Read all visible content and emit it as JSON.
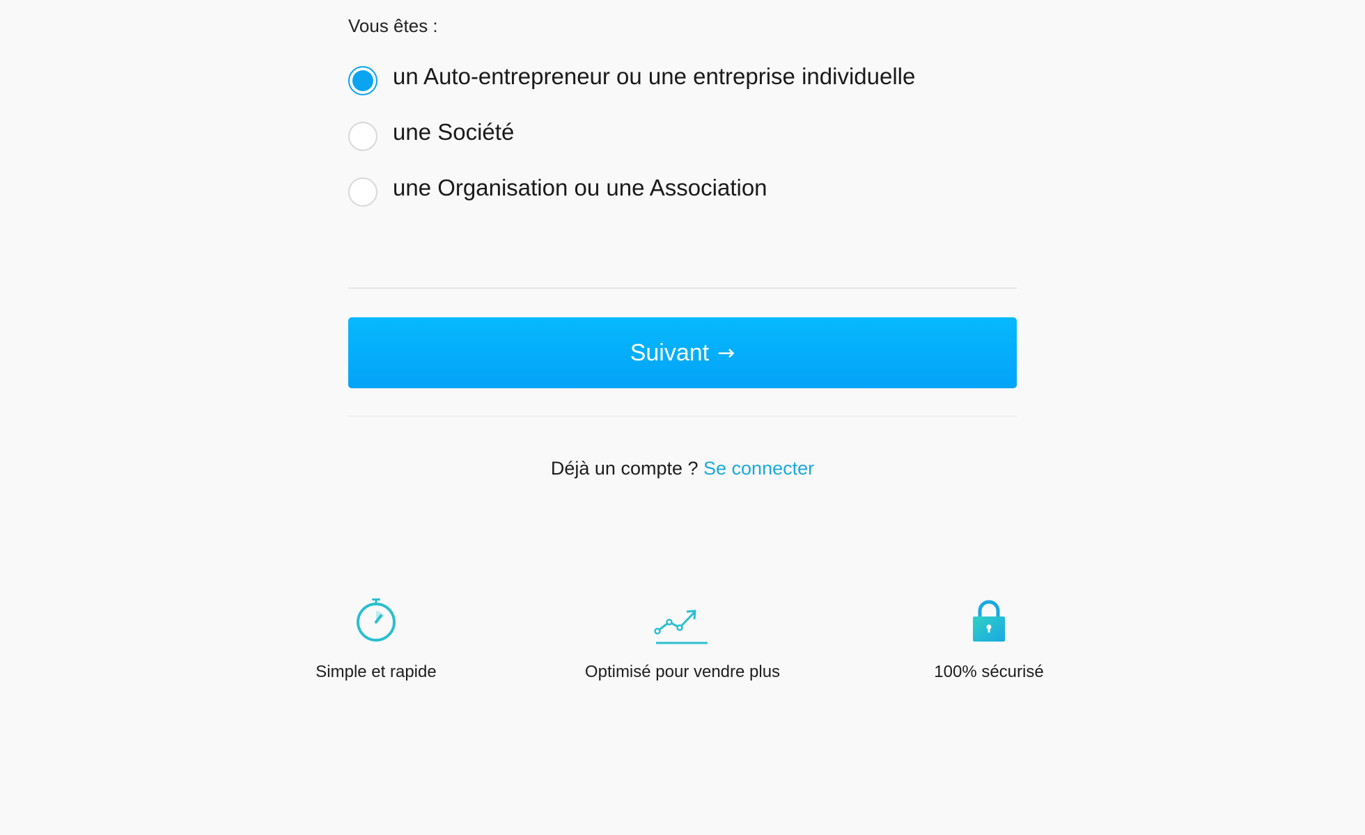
{
  "form": {
    "question": "Vous êtes :",
    "options": [
      {
        "label": "un Auto-entrepreneur ou une entreprise individuelle",
        "selected": true
      },
      {
        "label": "une Société",
        "selected": false
      },
      {
        "label": "une Organisation ou une Association",
        "selected": false
      }
    ],
    "next_button": {
      "label": "Suivant",
      "arrow": "→"
    },
    "login": {
      "prompt": "Déjà un compte ?",
      "link_label": "Se connecter"
    }
  },
  "features": [
    {
      "icon": "stopwatch-icon",
      "label": "Simple et rapide"
    },
    {
      "icon": "trend-chart-icon",
      "label": "Optimisé pour vendre plus"
    },
    {
      "icon": "padlock-icon",
      "label": "100% sécurisé"
    }
  ],
  "colors": {
    "accent": "#0aa4f0",
    "button_top": "#06b9fc",
    "button_bottom": "#04a3f9",
    "link": "#1ba9dd",
    "icon_teal": "#2bbfcf",
    "background": "#f9f9f9"
  }
}
